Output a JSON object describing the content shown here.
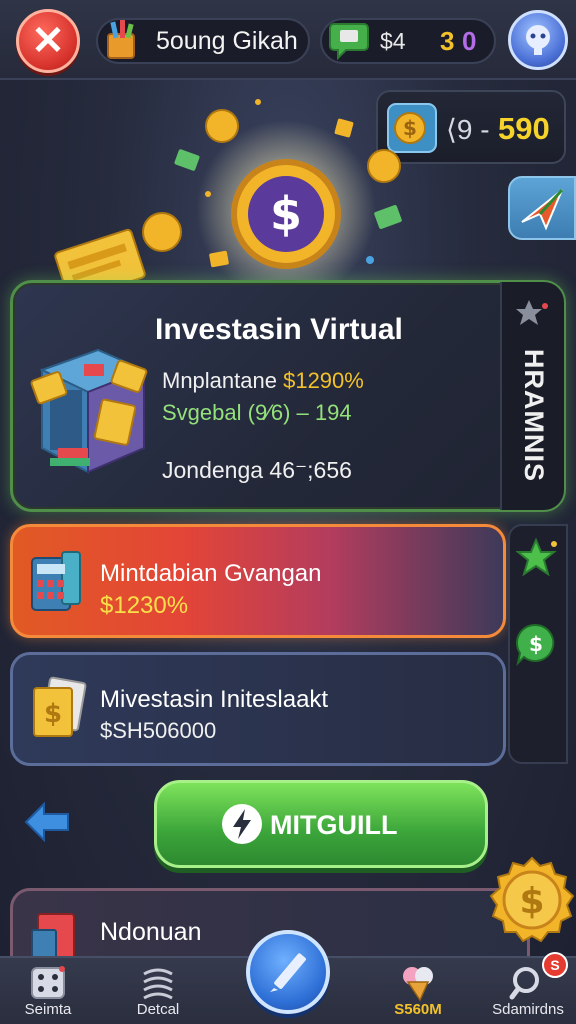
{
  "header": {
    "close_icon": "close-icon",
    "player_name": "5oung Gikah",
    "coin_value": "$4",
    "num_3": "3",
    "num_0": "0",
    "avatar_icon": "avatar-icon"
  },
  "balance": {
    "label": "⟨9 -",
    "value": "590"
  },
  "main_card": {
    "title": "Investasin Virtual",
    "stat1_label": "Mnplantane ",
    "stat1_value": "$1290%",
    "stat2": "Svgebal (9⁄6) – 194",
    "stat3": "Jondenga 46⁻;656",
    "side_label": "HRAMNIS"
  },
  "orange_card": {
    "title": "Mintdabian Gvangan",
    "value": "$1230%"
  },
  "blue_card": {
    "title": "Mivestasin Initeslaakt",
    "value": "$SH506000"
  },
  "action": {
    "label": "MITGUILL"
  },
  "partial_card": {
    "title": "Ndonuan"
  },
  "bottom_nav": {
    "items": [
      {
        "label": "Seimta"
      },
      {
        "label": "Detcal"
      },
      {
        "label": "S560M"
      },
      {
        "label": "Sdamirdns"
      }
    ],
    "badge": "S"
  },
  "colors": {
    "accent_gold": "#f3c12a",
    "accent_green": "#4caf50",
    "close_red": "#d4302a"
  }
}
